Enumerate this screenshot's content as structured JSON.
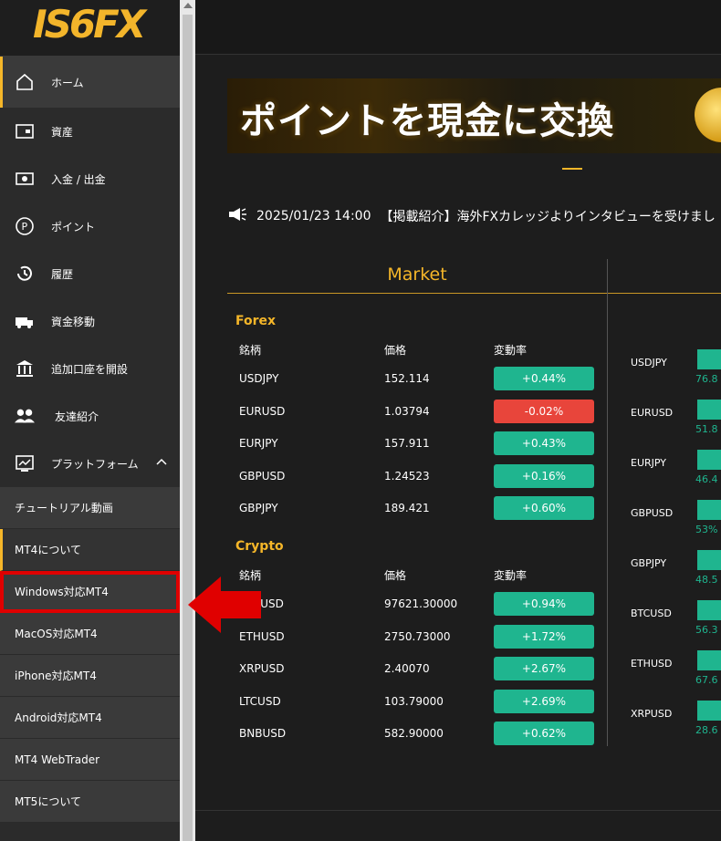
{
  "logo": {
    "text": "IS6FX"
  },
  "sidebar": {
    "items": [
      {
        "label": "ホーム",
        "icon": "home-icon",
        "active": true
      },
      {
        "label": "資産",
        "icon": "wallet-icon"
      },
      {
        "label": "入金 / 出金",
        "icon": "money-icon"
      },
      {
        "label": "ポイント",
        "icon": "point-icon"
      },
      {
        "label": "履歴",
        "icon": "history-icon"
      },
      {
        "label": "資金移動",
        "icon": "truck-icon"
      },
      {
        "label": "追加口座を開設",
        "icon": "bank-icon"
      },
      {
        "label": "友達紹介",
        "icon": "friends-icon"
      },
      {
        "label": "プラットフォーム",
        "icon": "chart-icon",
        "expanded": true
      }
    ],
    "sub_items": [
      {
        "label": "チュートリアル動画"
      },
      {
        "label": "MT4について"
      },
      {
        "label": "Windows対応MT4"
      },
      {
        "label": "MacOS対応MT4"
      },
      {
        "label": "iPhone対応MT4"
      },
      {
        "label": "Android対応MT4"
      },
      {
        "label": "MT4 WebTrader"
      },
      {
        "label": "MT5について"
      }
    ]
  },
  "banner": {
    "text": "ポイントを現金に交換"
  },
  "news": {
    "date": "2025/01/23 14:00",
    "text": "【掲載紹介】海外FXカレッジよりインタビューを受けまし"
  },
  "market": {
    "title": "Market",
    "headers": {
      "symbol": "銘柄",
      "price": "価格",
      "change": "変動率"
    },
    "forex": {
      "title": "Forex",
      "rows": [
        {
          "symbol": "USDJPY",
          "price": "152.114",
          "change": "+0.44%",
          "dir": "up"
        },
        {
          "symbol": "EURUSD",
          "price": "1.03794",
          "change": "-0.02%",
          "dir": "down"
        },
        {
          "symbol": "EURJPY",
          "price": "157.911",
          "change": "+0.43%",
          "dir": "up"
        },
        {
          "symbol": "GBPUSD",
          "price": "1.24523",
          "change": "+0.16%",
          "dir": "up"
        },
        {
          "symbol": "GBPJPY",
          "price": "189.421",
          "change": "+0.60%",
          "dir": "up"
        }
      ]
    },
    "crypto": {
      "title": "Crypto",
      "rows": [
        {
          "symbol": "BTCUSD",
          "price": "97621.30000",
          "change": "+0.94%",
          "dir": "up"
        },
        {
          "symbol": "ETHUSD",
          "price": "2750.73000",
          "change": "+1.72%",
          "dir": "up"
        },
        {
          "symbol": "XRPUSD",
          "price": "2.40070",
          "change": "+2.67%",
          "dir": "up"
        },
        {
          "symbol": "LTCUSD",
          "price": "103.79000",
          "change": "+2.69%",
          "dir": "up"
        },
        {
          "symbol": "BNBUSD",
          "price": "582.90000",
          "change": "+0.62%",
          "dir": "up"
        }
      ]
    }
  },
  "sentiment": [
    {
      "symbol": "USDJPY",
      "pct": "76.8"
    },
    {
      "symbol": "EURUSD",
      "pct": "51.8"
    },
    {
      "symbol": "EURJPY",
      "pct": "46.4"
    },
    {
      "symbol": "GBPUSD",
      "pct": "53%"
    },
    {
      "symbol": "GBPJPY",
      "pct": "48.5"
    },
    {
      "symbol": "BTCUSD",
      "pct": "56.3"
    },
    {
      "symbol": "ETHUSD",
      "pct": "67.6"
    },
    {
      "symbol": "XRPUSD",
      "pct": "28.6"
    }
  ],
  "colors": {
    "accent": "#f5b629",
    "up": "#1fb58f",
    "down": "#e8453b",
    "highlight": "#e00000"
  }
}
